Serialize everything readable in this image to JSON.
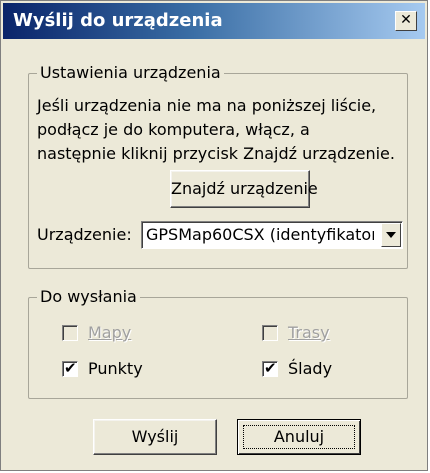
{
  "window": {
    "title": "Wyślij do urządzenia",
    "close_glyph": "✕"
  },
  "settings": {
    "group_label": "Ustawienia urządzenia",
    "description_lines": [
      "Jeśli urządzenia nie ma na poniższej liście,",
      "podłącz je do komputera, włącz, a",
      "następnie kliknij przycisk Znajdź urządzenie."
    ],
    "find_button_label": "Znajdź urządzenie",
    "device_label": "Urządzenie:",
    "device_value": "GPSMap60CSX (identyfikator"
  },
  "send": {
    "group_label": "Do wysłania",
    "items": [
      {
        "label": "Mapy",
        "checked": false,
        "enabled": false
      },
      {
        "label": "Trasy",
        "checked": false,
        "enabled": false
      },
      {
        "label": "Punkty",
        "checked": true,
        "enabled": true
      },
      {
        "label": "Ślady",
        "checked": true,
        "enabled": true
      }
    ],
    "check_glyph": "✔"
  },
  "buttons": {
    "send_label": "Wyślij",
    "cancel_label": "Anuluj"
  }
}
